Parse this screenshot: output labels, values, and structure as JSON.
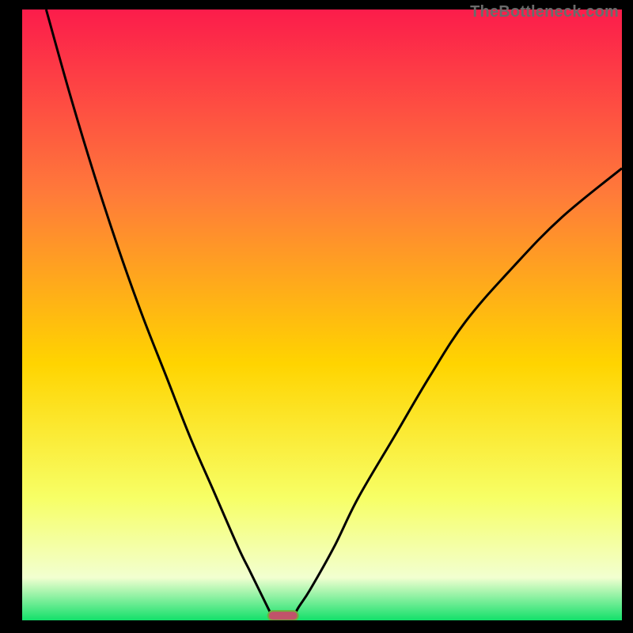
{
  "watermark": "TheBottleneck.com",
  "colors": {
    "frame": "#000000",
    "gradient_top": "#fc1c4b",
    "gradient_mid_upper": "#ff7a3a",
    "gradient_mid": "#ffd400",
    "gradient_lower": "#f7ff66",
    "gradient_pale": "#f2ffd0",
    "gradient_bottom": "#13e06a",
    "curve": "#000000",
    "marker_fill": "#c1536a",
    "marker_stroke": "#6fae3e"
  },
  "chart_data": {
    "type": "line",
    "title": "",
    "xlabel": "",
    "ylabel": "",
    "xlim": [
      0,
      100
    ],
    "ylim": [
      0,
      100
    ],
    "series": [
      {
        "name": "left-branch",
        "x": [
          4,
          8,
          12,
          16,
          20,
          24,
          28,
          32,
          36,
          38,
          40,
          41,
          42
        ],
        "y": [
          100,
          86,
          73,
          61,
          50,
          40,
          30,
          21,
          12,
          8,
          4,
          2,
          0
        ]
      },
      {
        "name": "right-branch",
        "x": [
          45,
          46,
          48,
          52,
          56,
          62,
          68,
          74,
          82,
          90,
          100
        ],
        "y": [
          0,
          2,
          5,
          12,
          20,
          30,
          40,
          49,
          58,
          66,
          74
        ]
      }
    ],
    "marker": {
      "x_center": 43.5,
      "width": 5,
      "y": 0.5
    },
    "gradient_stops": [
      {
        "pos": 0.0,
        "color": "#fc1c4b"
      },
      {
        "pos": 0.3,
        "color": "#ff7a3a"
      },
      {
        "pos": 0.58,
        "color": "#ffd400"
      },
      {
        "pos": 0.8,
        "color": "#f7ff66"
      },
      {
        "pos": 0.93,
        "color": "#f2ffd0"
      },
      {
        "pos": 1.0,
        "color": "#13e06a"
      }
    ]
  }
}
